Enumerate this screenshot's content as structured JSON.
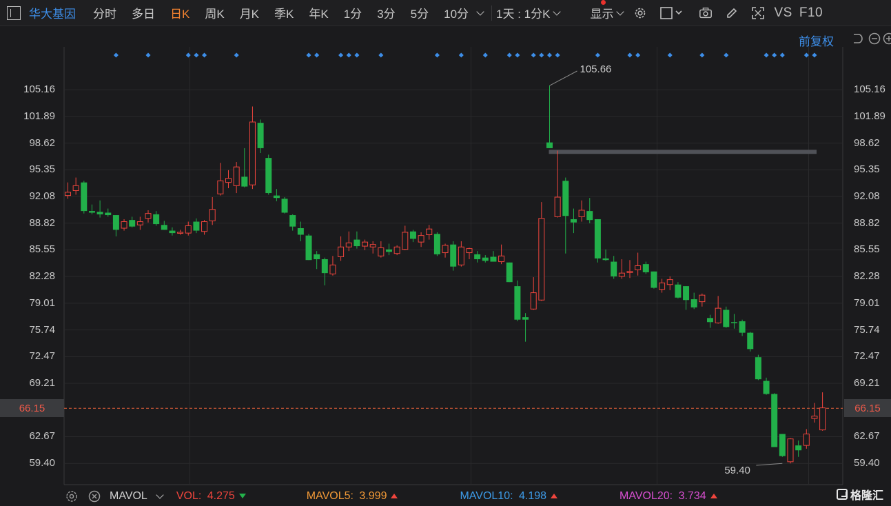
{
  "toolbar": {
    "stock_name": "华大基因",
    "tabs": [
      "分时",
      "多日",
      "日K",
      "周K",
      "月K",
      "季K",
      "年K",
      "1分",
      "3分",
      "5分",
      "10分"
    ],
    "active_tab": "日K",
    "interval_select": "1天 : 1分K",
    "display_label": "显示",
    "vs_label": "VS",
    "f10_label": "F10"
  },
  "adjustment": "前复权",
  "colors": {
    "up": "#f0453d",
    "down": "#22b04a",
    "accent": "#3d8ee8",
    "active_tab": "#f3822f",
    "markers": "#3d8ee8"
  },
  "chart_data": {
    "type": "candlestick",
    "y_ticks": [
      "105.16",
      "101.89",
      "98.62",
      "95.35",
      "92.08",
      "88.82",
      "85.55",
      "82.28",
      "79.01",
      "75.74",
      "72.47",
      "69.21",
      "59.40",
      "62.67"
    ],
    "ylim": [
      56.8,
      110.4
    ],
    "current_price": "66.15",
    "high_annotation": {
      "label": "105.66",
      "value": 105.66
    },
    "low_annotation": {
      "label": "59.40",
      "value": 59.4
    },
    "marker_index": [
      6,
      10,
      15,
      16,
      17,
      21,
      30,
      31,
      34,
      35,
      36,
      39,
      46,
      49,
      52,
      55,
      56,
      58,
      59,
      60,
      61,
      66,
      70,
      71,
      75,
      79,
      82,
      87,
      88,
      89,
      92,
      93
    ],
    "candles": [
      {
        "o": 92.2,
        "h": 93.8,
        "l": 91.8,
        "c": 92.6
      },
      {
        "o": 92.8,
        "h": 94.4,
        "l": 92.3,
        "c": 93.4
      },
      {
        "o": 93.8,
        "h": 94.0,
        "l": 90.0,
        "c": 90.3
      },
      {
        "o": 90.3,
        "h": 91.1,
        "l": 89.9,
        "c": 90.1
      },
      {
        "o": 90.2,
        "h": 91.6,
        "l": 89.5,
        "c": 89.9
      },
      {
        "o": 90.1,
        "h": 90.6,
        "l": 89.6,
        "c": 89.8
      },
      {
        "o": 89.8,
        "h": 89.8,
        "l": 87.2,
        "c": 88.0
      },
      {
        "o": 88.2,
        "h": 89.3,
        "l": 87.9,
        "c": 89.0
      },
      {
        "o": 89.2,
        "h": 89.6,
        "l": 88.3,
        "c": 88.4
      },
      {
        "o": 88.6,
        "h": 89.6,
        "l": 88.0,
        "c": 89.0
      },
      {
        "o": 89.4,
        "h": 90.4,
        "l": 88.9,
        "c": 90.0
      },
      {
        "o": 89.9,
        "h": 90.3,
        "l": 88.5,
        "c": 88.7
      },
      {
        "o": 88.6,
        "h": 89.1,
        "l": 88.0,
        "c": 88.0
      },
      {
        "o": 87.9,
        "h": 88.3,
        "l": 87.3,
        "c": 87.6
      },
      {
        "o": 87.6,
        "h": 88.0,
        "l": 87.4,
        "c": 87.7
      },
      {
        "o": 87.6,
        "h": 89.0,
        "l": 87.3,
        "c": 88.5
      },
      {
        "o": 89.0,
        "h": 89.4,
        "l": 87.6,
        "c": 87.9
      },
      {
        "o": 87.8,
        "h": 89.2,
        "l": 87.4,
        "c": 89.0
      },
      {
        "o": 89.1,
        "h": 92.0,
        "l": 88.6,
        "c": 90.5
      },
      {
        "o": 92.4,
        "h": 96.2,
        "l": 92.2,
        "c": 94.0
      },
      {
        "o": 93.8,
        "h": 95.3,
        "l": 93.1,
        "c": 94.3
      },
      {
        "o": 93.4,
        "h": 96.3,
        "l": 92.5,
        "c": 95.7
      },
      {
        "o": 94.5,
        "h": 98.0,
        "l": 93.2,
        "c": 93.3
      },
      {
        "o": 93.5,
        "h": 103.1,
        "l": 93.0,
        "c": 101.2
      },
      {
        "o": 101.1,
        "h": 101.5,
        "l": 97.4,
        "c": 98.0
      },
      {
        "o": 96.8,
        "h": 97.2,
        "l": 92.3,
        "c": 92.5
      },
      {
        "o": 92.2,
        "h": 93.0,
        "l": 91.5,
        "c": 91.9
      },
      {
        "o": 91.8,
        "h": 92.0,
        "l": 90.0,
        "c": 90.1
      },
      {
        "o": 89.8,
        "h": 89.9,
        "l": 87.9,
        "c": 88.4
      },
      {
        "o": 88.2,
        "h": 89.0,
        "l": 86.6,
        "c": 87.4
      },
      {
        "o": 87.3,
        "h": 87.5,
        "l": 84.3,
        "c": 84.3
      },
      {
        "o": 85.0,
        "h": 85.4,
        "l": 83.2,
        "c": 84.4
      },
      {
        "o": 84.4,
        "h": 84.6,
        "l": 81.2,
        "c": 82.7
      },
      {
        "o": 82.6,
        "h": 84.8,
        "l": 82.4,
        "c": 83.7
      },
      {
        "o": 84.7,
        "h": 87.2,
        "l": 84.2,
        "c": 85.9
      },
      {
        "o": 85.9,
        "h": 87.8,
        "l": 85.4,
        "c": 86.4
      },
      {
        "o": 86.8,
        "h": 87.8,
        "l": 85.7,
        "c": 86.0
      },
      {
        "o": 86.0,
        "h": 86.8,
        "l": 85.5,
        "c": 86.5
      },
      {
        "o": 85.9,
        "h": 86.6,
        "l": 85.1,
        "c": 86.2
      },
      {
        "o": 84.8,
        "h": 86.6,
        "l": 84.6,
        "c": 85.8
      },
      {
        "o": 85.6,
        "h": 86.3,
        "l": 84.9,
        "c": 85.3
      },
      {
        "o": 85.1,
        "h": 86.1,
        "l": 84.9,
        "c": 85.9
      },
      {
        "o": 85.6,
        "h": 88.5,
        "l": 85.5,
        "c": 87.7
      },
      {
        "o": 87.8,
        "h": 88.0,
        "l": 86.5,
        "c": 86.9
      },
      {
        "o": 86.5,
        "h": 87.7,
        "l": 85.9,
        "c": 87.3
      },
      {
        "o": 87.4,
        "h": 88.6,
        "l": 86.8,
        "c": 88.1
      },
      {
        "o": 87.5,
        "h": 87.7,
        "l": 84.8,
        "c": 85.0
      },
      {
        "o": 85.2,
        "h": 86.3,
        "l": 84.6,
        "c": 86.1
      },
      {
        "o": 86.2,
        "h": 86.6,
        "l": 83.0,
        "c": 83.5
      },
      {
        "o": 83.7,
        "h": 86.6,
        "l": 83.5,
        "c": 85.9
      },
      {
        "o": 85.2,
        "h": 85.8,
        "l": 84.4,
        "c": 85.7
      },
      {
        "o": 85.0,
        "h": 85.4,
        "l": 84.0,
        "c": 84.4
      },
      {
        "o": 84.6,
        "h": 84.9,
        "l": 84.0,
        "c": 84.2
      },
      {
        "o": 84.7,
        "h": 85.4,
        "l": 84.2,
        "c": 84.1
      },
      {
        "o": 84.1,
        "h": 86.2,
        "l": 83.8,
        "c": 84.8
      },
      {
        "o": 84.0,
        "h": 84.0,
        "l": 81.6,
        "c": 81.6
      },
      {
        "o": 81.1,
        "h": 81.8,
        "l": 76.8,
        "c": 77.0
      },
      {
        "o": 77.3,
        "h": 77.8,
        "l": 74.3,
        "c": 77.0
      },
      {
        "o": 78.3,
        "h": 82.2,
        "l": 78.2,
        "c": 80.3
      },
      {
        "o": 79.4,
        "h": 91.4,
        "l": 79.3,
        "c": 89.4
      },
      {
        "o": 98.7,
        "h": 105.66,
        "l": 98.0,
        "c": 98.0
      },
      {
        "o": 89.6,
        "h": 97.7,
        "l": 89.5,
        "c": 92.0
      },
      {
        "o": 94.0,
        "h": 94.4,
        "l": 85.1,
        "c": 89.7
      },
      {
        "o": 89.3,
        "h": 90.6,
        "l": 87.6,
        "c": 88.9
      },
      {
        "o": 89.6,
        "h": 91.6,
        "l": 89.0,
        "c": 90.4
      },
      {
        "o": 90.3,
        "h": 91.9,
        "l": 88.8,
        "c": 89.2
      },
      {
        "o": 89.3,
        "h": 89.3,
        "l": 84.0,
        "c": 84.5
      },
      {
        "o": 84.5,
        "h": 85.6,
        "l": 84.2,
        "c": 84.3
      },
      {
        "o": 84.1,
        "h": 84.8,
        "l": 82.0,
        "c": 82.3
      },
      {
        "o": 82.3,
        "h": 84.4,
        "l": 82.0,
        "c": 82.7
      },
      {
        "o": 82.8,
        "h": 84.3,
        "l": 82.1,
        "c": 82.9
      },
      {
        "o": 83.1,
        "h": 85.2,
        "l": 82.4,
        "c": 83.6
      },
      {
        "o": 83.8,
        "h": 84.1,
        "l": 82.6,
        "c": 82.8
      },
      {
        "o": 82.9,
        "h": 82.9,
        "l": 80.8,
        "c": 80.9
      },
      {
        "o": 80.7,
        "h": 82.0,
        "l": 80.3,
        "c": 81.5
      },
      {
        "o": 81.3,
        "h": 82.3,
        "l": 80.6,
        "c": 81.9
      },
      {
        "o": 81.3,
        "h": 81.6,
        "l": 79.6,
        "c": 79.7
      },
      {
        "o": 81.1,
        "h": 81.1,
        "l": 78.2,
        "c": 79.4
      },
      {
        "o": 79.5,
        "h": 80.3,
        "l": 78.3,
        "c": 78.5
      },
      {
        "o": 79.2,
        "h": 80.2,
        "l": 78.6,
        "c": 80.0
      },
      {
        "o": 77.2,
        "h": 77.6,
        "l": 76.0,
        "c": 76.7
      },
      {
        "o": 76.6,
        "h": 79.9,
        "l": 76.5,
        "c": 78.4
      },
      {
        "o": 78.2,
        "h": 78.6,
        "l": 76.0,
        "c": 76.1
      },
      {
        "o": 76.7,
        "h": 77.7,
        "l": 75.9,
        "c": 76.6
      },
      {
        "o": 76.8,
        "h": 77.0,
        "l": 75.0,
        "c": 75.4
      },
      {
        "o": 75.4,
        "h": 75.5,
        "l": 73.1,
        "c": 73.4
      },
      {
        "o": 72.4,
        "h": 72.7,
        "l": 69.6,
        "c": 69.7
      },
      {
        "o": 69.5,
        "h": 69.9,
        "l": 67.8,
        "c": 67.9
      },
      {
        "o": 67.9,
        "h": 68.0,
        "l": 61.4,
        "c": 61.4
      },
      {
        "o": 63.0,
        "h": 63.0,
        "l": 60.2,
        "c": 60.3
      },
      {
        "o": 59.6,
        "h": 62.5,
        "l": 59.4,
        "c": 62.4
      },
      {
        "o": 61.6,
        "h": 62.2,
        "l": 60.2,
        "c": 61.0
      },
      {
        "o": 61.6,
        "h": 63.6,
        "l": 61.2,
        "c": 63.0
      },
      {
        "o": 64.9,
        "h": 66.8,
        "l": 64.4,
        "c": 65.2
      },
      {
        "o": 63.5,
        "h": 68.1,
        "l": 63.4,
        "c": 66.2
      }
    ]
  },
  "indicators": {
    "name": "MAVOL",
    "vol": {
      "label": "VOL:",
      "value": "4.275",
      "dir": "down",
      "color": "#f0453d"
    },
    "ma5": {
      "label": "MAVOL5:",
      "value": "3.999",
      "dir": "up",
      "color": "#f39a37"
    },
    "ma10": {
      "label": "MAVOL10:",
      "value": "4.198",
      "dir": "up",
      "color": "#3d9be8"
    },
    "ma20": {
      "label": "MAVOL20:",
      "value": "3.734",
      "dir": "up",
      "color": "#d74fd0"
    }
  },
  "logo_text": "格隆汇"
}
